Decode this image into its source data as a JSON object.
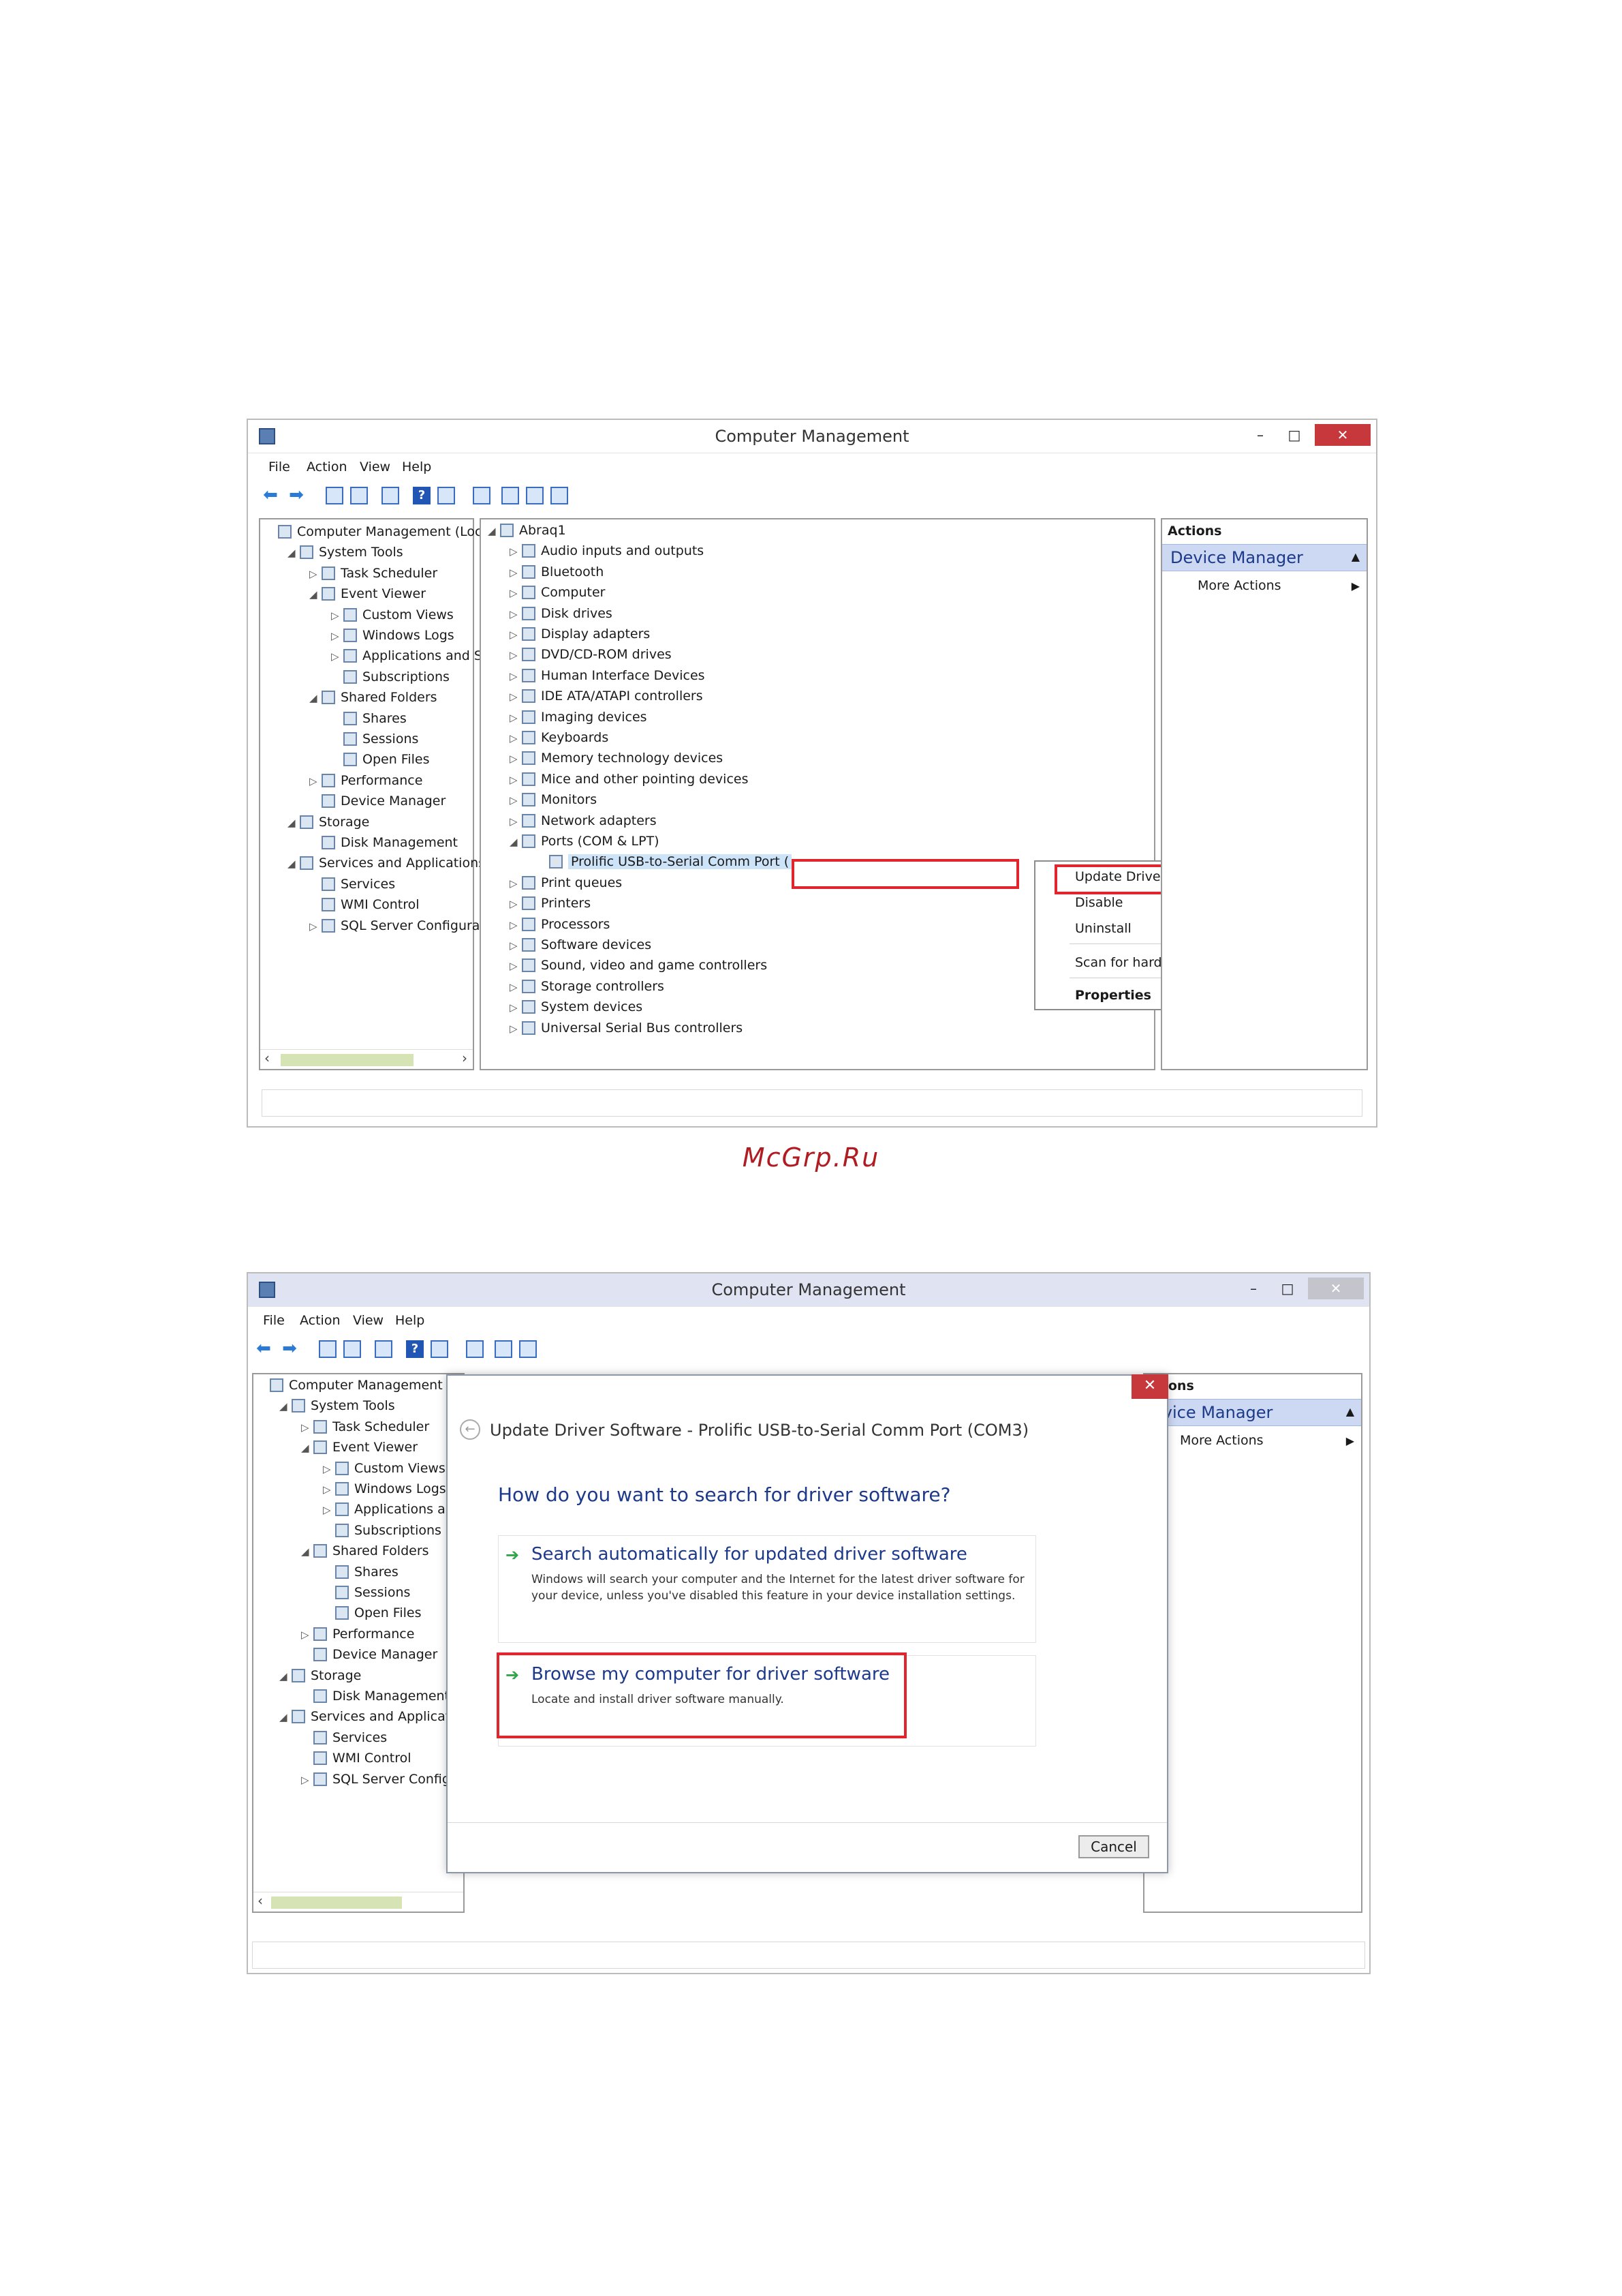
{
  "window_title": "Computer Management",
  "window_buttons": {
    "minimize": "–",
    "maximize": "□",
    "close": "✕"
  },
  "menu": [
    "File",
    "Action",
    "View",
    "Help"
  ],
  "left_tree": [
    {
      "label": "Computer Management (Local",
      "expander": "",
      "icon": "computer-management-icon"
    },
    {
      "label": "System Tools",
      "expander": "◢",
      "icon": "tools-icon"
    },
    {
      "label": "Task Scheduler",
      "expander": "▷",
      "icon": "clock-icon"
    },
    {
      "label": "Event Viewer",
      "expander": "◢",
      "icon": "event-viewer-icon"
    },
    {
      "label": "Custom Views",
      "expander": "▷",
      "icon": "folder-icon"
    },
    {
      "label": "Windows Logs",
      "expander": "▷",
      "icon": "folder-icon"
    },
    {
      "label": "Applications and Se",
      "expander": "▷",
      "icon": "folder-icon"
    },
    {
      "label": "Subscriptions",
      "expander": "",
      "icon": "subscriptions-icon"
    },
    {
      "label": "Shared Folders",
      "expander": "◢",
      "icon": "shared-folder-icon"
    },
    {
      "label": "Shares",
      "expander": "",
      "icon": "shared-folder-icon"
    },
    {
      "label": "Sessions",
      "expander": "",
      "icon": "shared-folder-icon"
    },
    {
      "label": "Open Files",
      "expander": "",
      "icon": "shared-folder-icon"
    },
    {
      "label": "Performance",
      "expander": "▷",
      "icon": "performance-icon"
    },
    {
      "label": "Device Manager",
      "expander": "",
      "icon": "device-manager-icon"
    },
    {
      "label": "Storage",
      "expander": "◢",
      "icon": "storage-icon"
    },
    {
      "label": "Disk Management",
      "expander": "",
      "icon": "disk-icon"
    },
    {
      "label": "Services and Applications",
      "expander": "◢",
      "icon": "services-apps-icon"
    },
    {
      "label": "Services",
      "expander": "",
      "icon": "services-icon"
    },
    {
      "label": "WMI Control",
      "expander": "",
      "icon": "wmi-icon"
    },
    {
      "label": "SQL Server Configuratic",
      "expander": "▷",
      "icon": "sql-icon"
    }
  ],
  "left_tree_2": [
    "Computer Management (Local",
    "System Tools",
    "Task Scheduler",
    "Event Viewer",
    "Custom Views",
    "Windows Logs",
    "Applications and",
    "Subscriptions",
    "Shared Folders",
    "Shares",
    "Sessions",
    "Open Files",
    "Performance",
    "Device Manager",
    "Storage",
    "Disk Management",
    "Services and Applicatio",
    "Services",
    "WMI Control",
    "SQL Server Configu"
  ],
  "device_tree": {
    "root": "Abraq1",
    "items": [
      "Audio inputs and outputs",
      "Bluetooth",
      "Computer",
      "Disk drives",
      "Display adapters",
      "DVD/CD-ROM drives",
      "Human Interface Devices",
      "IDE ATA/ATAPI controllers",
      "Imaging devices",
      "Keyboards",
      "Memory technology devices",
      "Mice and other pointing devices",
      "Monitors",
      "Network adapters",
      "Ports (COM & LPT)",
      "Prolific USB-to-Serial Comm Port (",
      "Print queues",
      "Printers",
      "Processors",
      "Software devices",
      "Sound, video and game controllers",
      "Storage controllers",
      "System devices",
      "Universal Serial Bus controllers"
    ]
  },
  "context_menu": {
    "update": "Update Driver Software...",
    "disable": "Disable",
    "uninstall": "Uninstall",
    "scan": "Scan for hardware changes",
    "properties": "Properties"
  },
  "actions_pane": {
    "header": "Actions",
    "section": "Device Manager",
    "section_2": "evice Manager",
    "header_2": "ctions",
    "more": "More Actions"
  },
  "watermark": "McGrp.Ru",
  "dialog": {
    "title": "Update Driver Software - Prolific USB-to-Serial Comm Port (COM3)",
    "question": "How do you want to search for driver software?",
    "option1_title": "Search automatically for updated driver software",
    "option1_desc": "Windows will search your computer and the Internet for the latest driver software for your device, unless you've disabled this feature in your device installation settings.",
    "option2_title": "Browse my computer for driver software",
    "option2_desc": "Locate and install driver software manually.",
    "cancel": "Cancel"
  },
  "colors": {
    "highlight": "#e0262c",
    "watermark": "#b01c22",
    "link_blue": "#1d3a8a",
    "close_red": "#c7383c"
  }
}
